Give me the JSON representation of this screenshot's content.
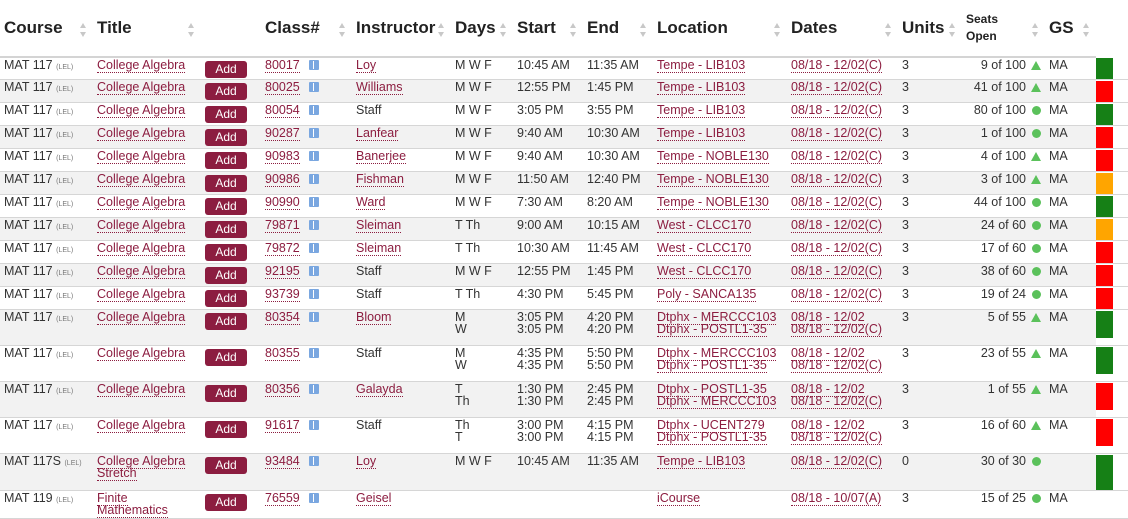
{
  "headers": {
    "course": "Course",
    "title": "Title",
    "class": "Class#",
    "instructor": "Instructor",
    "days": "Days",
    "start": "Start",
    "end": "End",
    "location": "Location",
    "dates": "Dates",
    "units": "Units",
    "seats_line1": "Seats",
    "seats_line2": "Open",
    "gs": "GS"
  },
  "add_label": "Add",
  "level_tag": "(LEL)",
  "status_colors": {
    "green": "#168016",
    "red": "#ff0000",
    "orange": "#ffa500"
  },
  "rows": [
    {
      "course": "MAT 117",
      "title": "College Algebra",
      "class": "80017",
      "instructor": "Loy",
      "instructor_link": true,
      "days": [
        "M W F"
      ],
      "start": [
        "10:45 AM"
      ],
      "end": [
        "11:35 AM"
      ],
      "location": [
        "Tempe - LIB103"
      ],
      "dates": [
        "08/18 - 12/02(C)"
      ],
      "units": "3",
      "seats": "9 of 100",
      "indicator": "triangle",
      "gs": "MA",
      "status": "green"
    },
    {
      "course": "MAT 117",
      "title": "College Algebra",
      "class": "80025",
      "instructor": "Williams",
      "instructor_link": true,
      "days": [
        "M W F"
      ],
      "start": [
        "12:55 PM"
      ],
      "end": [
        "1:45 PM"
      ],
      "location": [
        "Tempe - LIB103"
      ],
      "dates": [
        "08/18 - 12/02(C)"
      ],
      "units": "3",
      "seats": "41 of 100",
      "indicator": "triangle",
      "gs": "MA",
      "status": "red"
    },
    {
      "course": "MAT 117",
      "title": "College Algebra",
      "class": "80054",
      "instructor": "Staff",
      "instructor_link": false,
      "days": [
        "M W F"
      ],
      "start": [
        "3:05 PM"
      ],
      "end": [
        "3:55 PM"
      ],
      "location": [
        "Tempe - LIB103"
      ],
      "dates": [
        "08/18 - 12/02(C)"
      ],
      "units": "3",
      "seats": "80 of 100",
      "indicator": "dot",
      "gs": "MA",
      "status": "green"
    },
    {
      "course": "MAT 117",
      "title": "College Algebra",
      "class": "90287",
      "instructor": "Lanfear",
      "instructor_link": true,
      "days": [
        "M W F"
      ],
      "start": [
        "9:40 AM"
      ],
      "end": [
        "10:30 AM"
      ],
      "location": [
        "Tempe - LIB103"
      ],
      "dates": [
        "08/18 - 12/02(C)"
      ],
      "units": "3",
      "seats": "1 of 100",
      "indicator": "dot",
      "gs": "MA",
      "status": "red"
    },
    {
      "course": "MAT 117",
      "title": "College Algebra",
      "class": "90983",
      "instructor": "Banerjee",
      "instructor_link": true,
      "days": [
        "M W F"
      ],
      "start": [
        "9:40 AM"
      ],
      "end": [
        "10:30 AM"
      ],
      "location": [
        "Tempe - NOBLE130"
      ],
      "dates": [
        "08/18 - 12/02(C)"
      ],
      "units": "3",
      "seats": "4 of 100",
      "indicator": "triangle",
      "gs": "MA",
      "status": "red"
    },
    {
      "course": "MAT 117",
      "title": "College Algebra",
      "class": "90986",
      "instructor": "Fishman",
      "instructor_link": true,
      "days": [
        "M W F"
      ],
      "start": [
        "11:50 AM"
      ],
      "end": [
        "12:40 PM"
      ],
      "location": [
        "Tempe - NOBLE130"
      ],
      "dates": [
        "08/18 - 12/02(C)"
      ],
      "units": "3",
      "seats": "3 of 100",
      "indicator": "triangle",
      "gs": "MA",
      "status": "orange"
    },
    {
      "course": "MAT 117",
      "title": "College Algebra",
      "class": "90990",
      "instructor": "Ward",
      "instructor_link": true,
      "days": [
        "M W F"
      ],
      "start": [
        "7:30 AM"
      ],
      "end": [
        "8:20 AM"
      ],
      "location": [
        "Tempe - NOBLE130"
      ],
      "dates": [
        "08/18 - 12/02(C)"
      ],
      "units": "3",
      "seats": "44 of 100",
      "indicator": "dot",
      "gs": "MA",
      "status": "green"
    },
    {
      "course": "MAT 117",
      "title": "College Algebra",
      "class": "79871",
      "instructor": "Sleiman",
      "instructor_link": true,
      "days": [
        "T Th"
      ],
      "start": [
        "9:00 AM"
      ],
      "end": [
        "10:15 AM"
      ],
      "location": [
        "West - CLCC170"
      ],
      "dates": [
        "08/18 - 12/02(C)"
      ],
      "units": "3",
      "seats": "24 of 60",
      "indicator": "dot",
      "gs": "MA",
      "status": "orange"
    },
    {
      "course": "MAT 117",
      "title": "College Algebra",
      "class": "79872",
      "instructor": "Sleiman",
      "instructor_link": true,
      "days": [
        "T Th"
      ],
      "start": [
        "10:30 AM"
      ],
      "end": [
        "11:45 AM"
      ],
      "location": [
        "West - CLCC170"
      ],
      "dates": [
        "08/18 - 12/02(C)"
      ],
      "units": "3",
      "seats": "17 of 60",
      "indicator": "dot",
      "gs": "MA",
      "status": "red"
    },
    {
      "course": "MAT 117",
      "title": "College Algebra",
      "class": "92195",
      "instructor": "Staff",
      "instructor_link": false,
      "days": [
        "M W F"
      ],
      "start": [
        "12:55 PM"
      ],
      "end": [
        "1:45 PM"
      ],
      "location": [
        "West - CLCC170"
      ],
      "dates": [
        "08/18 - 12/02(C)"
      ],
      "units": "3",
      "seats": "38 of 60",
      "indicator": "dot",
      "gs": "MA",
      "status": "red"
    },
    {
      "course": "MAT 117",
      "title": "College Algebra",
      "class": "93739",
      "instructor": "Staff",
      "instructor_link": false,
      "days": [
        "T Th"
      ],
      "start": [
        "4:30 PM"
      ],
      "end": [
        "5:45 PM"
      ],
      "location": [
        "Poly - SANCA135"
      ],
      "dates": [
        "08/18 - 12/02(C)"
      ],
      "units": "3",
      "seats": "19 of 24",
      "indicator": "dot",
      "gs": "MA",
      "status": "red"
    },
    {
      "course": "MAT 117",
      "title": "College Algebra",
      "class": "80354",
      "instructor": "Bloom",
      "instructor_link": true,
      "days": [
        "M",
        "W"
      ],
      "start": [
        "3:05 PM",
        "3:05 PM"
      ],
      "end": [
        "4:20 PM",
        "4:20 PM"
      ],
      "location": [
        "Dtphx - MERCCC103",
        "Dtphx - POSTL1-35"
      ],
      "dates": [
        "08/18 - 12/02",
        "08/18 - 12/02(C)"
      ],
      "units": "3",
      "seats": "5 of 55",
      "indicator": "triangle",
      "gs": "MA",
      "status": "green"
    },
    {
      "course": "MAT 117",
      "title": "College Algebra",
      "class": "80355",
      "instructor": "Staff",
      "instructor_link": false,
      "days": [
        "M",
        "W"
      ],
      "start": [
        "4:35 PM",
        "4:35 PM"
      ],
      "end": [
        "5:50 PM",
        "5:50 PM"
      ],
      "location": [
        "Dtphx - MERCCC103",
        "Dtphx - POSTL1-35"
      ],
      "dates": [
        "08/18 - 12/02",
        "08/18 - 12/02(C)"
      ],
      "units": "3",
      "seats": "23 of 55",
      "indicator": "triangle",
      "gs": "MA",
      "status": "green"
    },
    {
      "course": "MAT 117",
      "title": "College Algebra",
      "class": "80356",
      "instructor": "Galayda",
      "instructor_link": true,
      "days": [
        "T",
        "Th"
      ],
      "start": [
        "1:30 PM",
        "1:30 PM"
      ],
      "end": [
        "2:45 PM",
        "2:45 PM"
      ],
      "location": [
        "Dtphx - POSTL1-35",
        "Dtphx - MERCCC103"
      ],
      "dates": [
        "08/18 - 12/02",
        "08/18 - 12/02(C)"
      ],
      "units": "3",
      "seats": "1 of 55",
      "indicator": "triangle",
      "gs": "MA",
      "status": "red"
    },
    {
      "course": "MAT 117",
      "title": "College Algebra",
      "class": "91617",
      "instructor": "Staff",
      "instructor_link": false,
      "days": [
        "Th",
        "T"
      ],
      "start": [
        "3:00 PM",
        "3:00 PM"
      ],
      "end": [
        "4:15 PM",
        "4:15 PM"
      ],
      "location": [
        "Dtphx - UCENT279",
        "Dtphx - POSTL1-35"
      ],
      "dates": [
        "08/18 - 12/02",
        "08/18 - 12/02(C)"
      ],
      "units": "3",
      "seats": "16 of 60",
      "indicator": "triangle",
      "gs": "MA",
      "status": "red"
    },
    {
      "course": "MAT 117S",
      "title": "College Algebra Stretch",
      "class": "93484",
      "instructor": "Loy",
      "instructor_link": true,
      "days": [
        "M W F"
      ],
      "start": [
        "10:45 AM"
      ],
      "end": [
        "11:35 AM"
      ],
      "location": [
        "Tempe - LIB103"
      ],
      "dates": [
        "08/18 - 12/02(C)"
      ],
      "units": "0",
      "seats": "30 of 30",
      "indicator": "dot",
      "gs": "",
      "status": "green"
    },
    {
      "course": "MAT 119",
      "title": "Finite Mathematics",
      "class": "76559",
      "instructor": "Geisel",
      "instructor_link": true,
      "days": [
        ""
      ],
      "start": [
        ""
      ],
      "end": [
        ""
      ],
      "location": [
        "iCourse"
      ],
      "dates": [
        "08/18 - 10/07(A)"
      ],
      "units": "3",
      "seats": "15 of 25",
      "indicator": "dot",
      "gs": "MA",
      "status": "none"
    }
  ]
}
